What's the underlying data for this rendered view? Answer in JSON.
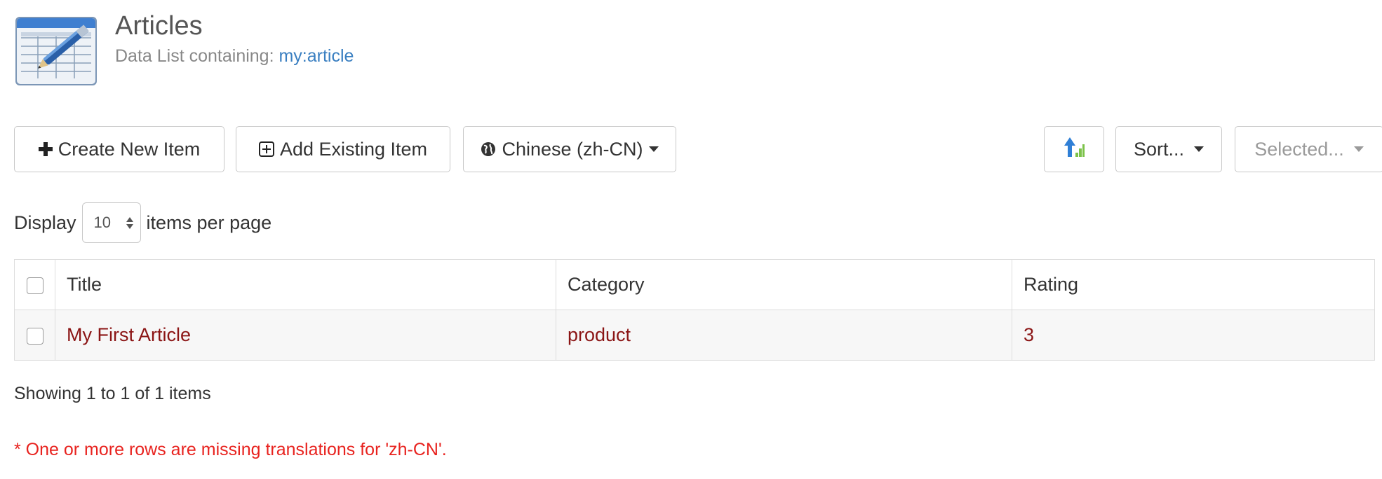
{
  "header": {
    "title": "Articles",
    "subtitle_prefix": "Data List containing: ",
    "content_type_link": "my:article",
    "icon": "datalist-pen-icon"
  },
  "toolbar": {
    "create_label": "Create New Item",
    "add_existing_label": "Add Existing Item",
    "language_label": "Chinese (zh-CN)",
    "sort_label": "Sort...",
    "selected_label": "Selected..."
  },
  "pagination": {
    "display_prefix": "Display",
    "page_size": "10",
    "display_suffix": "items per page"
  },
  "table": {
    "columns": [
      "Title",
      "Category",
      "Rating"
    ],
    "rows": [
      {
        "title": "My First Article",
        "category": "product",
        "rating": "3"
      }
    ]
  },
  "status": {
    "showing": "Showing 1 to 1 of 1 items",
    "warning": "* One or more rows are missing translations for 'zh-CN'."
  },
  "colors": {
    "link": "#3a7fc1",
    "row_text": "#8b1515",
    "warning": "#e8231f"
  }
}
